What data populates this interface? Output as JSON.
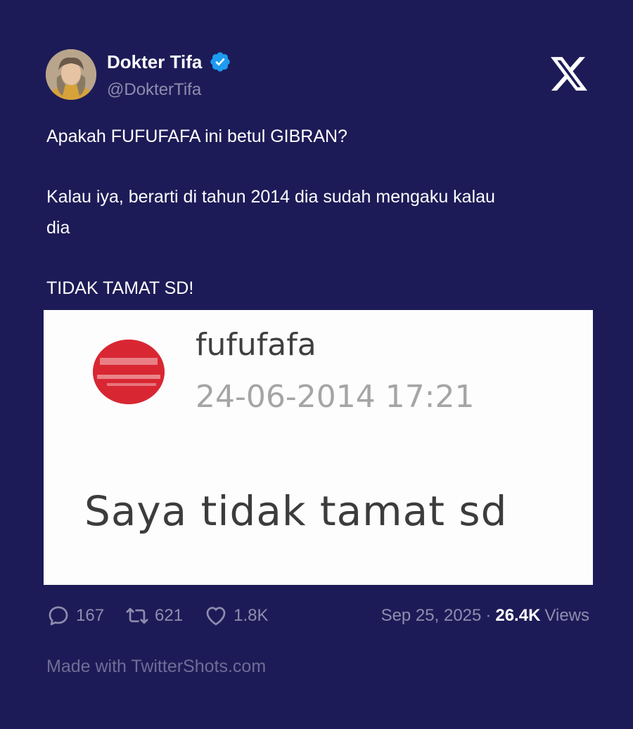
{
  "author": {
    "name": "Dokter Tifa",
    "handle": "@DokterTifa"
  },
  "tweet": {
    "line1": "Apakah FUFUFAFA ini betul GIBRAN?",
    "line2": "Kalau iya, berarti di tahun 2014 dia sudah mengaku kalau",
    "line3": "dia",
    "line4": "TIDAK TAMAT SD!"
  },
  "media": {
    "username": "fufufafa",
    "timestamp": "24-06-2014 17:21",
    "comment": "Saya tidak tamat sd"
  },
  "stats": {
    "replies": "167",
    "retweets": "621",
    "likes": "1.8K"
  },
  "meta": {
    "date": "Sep 25, 2025",
    "separator": "·",
    "views_count": "26.4K",
    "views_label": "Views"
  },
  "footer": "Made with TwitterShots.com",
  "icons": {
    "verified": "verified-badge-icon",
    "logo": "x-logo-icon",
    "reply": "reply-icon",
    "retweet": "retweet-icon",
    "like": "heart-icon"
  },
  "colors": {
    "background": "#1d1b57",
    "verified": "#1d9bf0",
    "muted": "#8e8dae"
  }
}
